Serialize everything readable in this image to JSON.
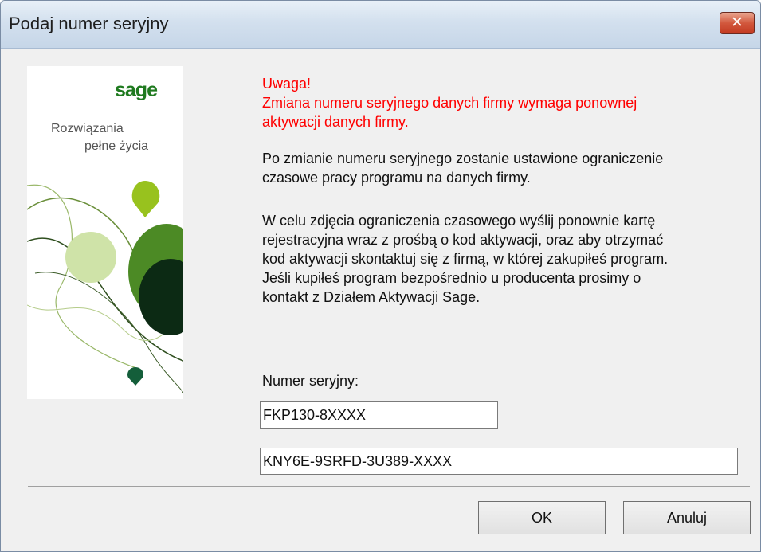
{
  "window": {
    "title": "Podaj numer seryjny",
    "close_glyph": "✕"
  },
  "brand": {
    "logo": "sage",
    "tagline_line1": "Rozwiązania",
    "tagline_line2": "pełne życia"
  },
  "warning": [
    "Uwaga!",
    "Zmiana numeru seryjnego danych firmy wymaga ponownej",
    "aktywacji  danych firmy."
  ],
  "info1": [
    "Po zmianie numeru seryjnego zostanie ustawione ograniczenie",
    "czasowe pracy programu na danych firmy."
  ],
  "info2": [
    "W celu zdjęcia ograniczenia czasowego wyślij ponownie kartę",
    "rejestracyjna wraz z prośbą o kod aktywacji, oraz aby otrzymać",
    "kod aktywacji skontaktuj się z firmą, w której zakupiłeś program.",
    "Jeśli kupiłeś program bezpośrednio u producenta prosimy o",
    "kontakt z Działem Aktywacji Sage."
  ],
  "serial": {
    "label": "Numer seryjny:",
    "value1": "FKP130-8XXXX",
    "value2": "KNY6E-9SRFD-3U389-XXXX"
  },
  "buttons": {
    "ok": "OK",
    "cancel": "Anuluj"
  },
  "colors": {
    "warning": "#ff0000",
    "brand_green": "#1f7a1f"
  }
}
